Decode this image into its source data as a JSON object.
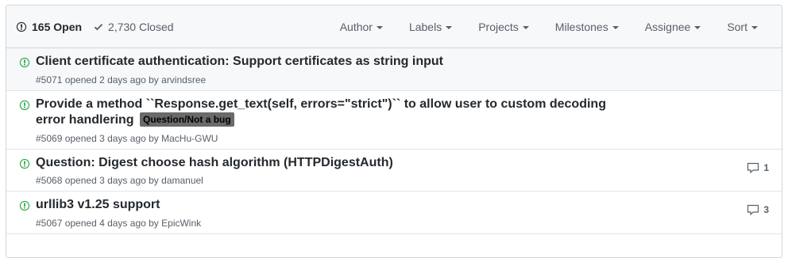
{
  "header": {
    "open_count": "165 Open",
    "closed_count": "2,730 Closed",
    "filters": [
      "Author",
      "Labels",
      "Projects",
      "Milestones",
      "Assignee",
      "Sort"
    ]
  },
  "issues": [
    {
      "title": "Client certificate authentication: Support certificates as string input",
      "meta_prefix": "#5071 opened 2 days ago by ",
      "author": "arvindsree",
      "label": null,
      "comments": null
    },
    {
      "title": "Provide a method ``Response.get_text(self, errors=\"strict\")`` to allow user to custom decoding error handlering",
      "meta_prefix": "#5069 opened 3 days ago by ",
      "author": "MacHu-GWU",
      "label": "Question/Not a bug",
      "comments": null
    },
    {
      "title": "Question: Digest choose hash algorithm (HTTPDigestAuth)",
      "meta_prefix": "#5068 opened 3 days ago by ",
      "author": "damanuel",
      "label": null,
      "comments": "1"
    },
    {
      "title": "urllib3 v1.25 support",
      "meta_prefix": "#5067 opened 4 days ago by ",
      "author": "EpicWink",
      "label": null,
      "comments": "3"
    }
  ],
  "colors": {
    "open_icon": "#28a745",
    "label_bg": "#6a6a6a",
    "header_bg": "#f6f8fa"
  },
  "icons": {
    "open_state": "issue-opened-icon",
    "closed_state": "check-icon",
    "issue_state": "issue-opened-icon",
    "comments": "comment-icon"
  }
}
